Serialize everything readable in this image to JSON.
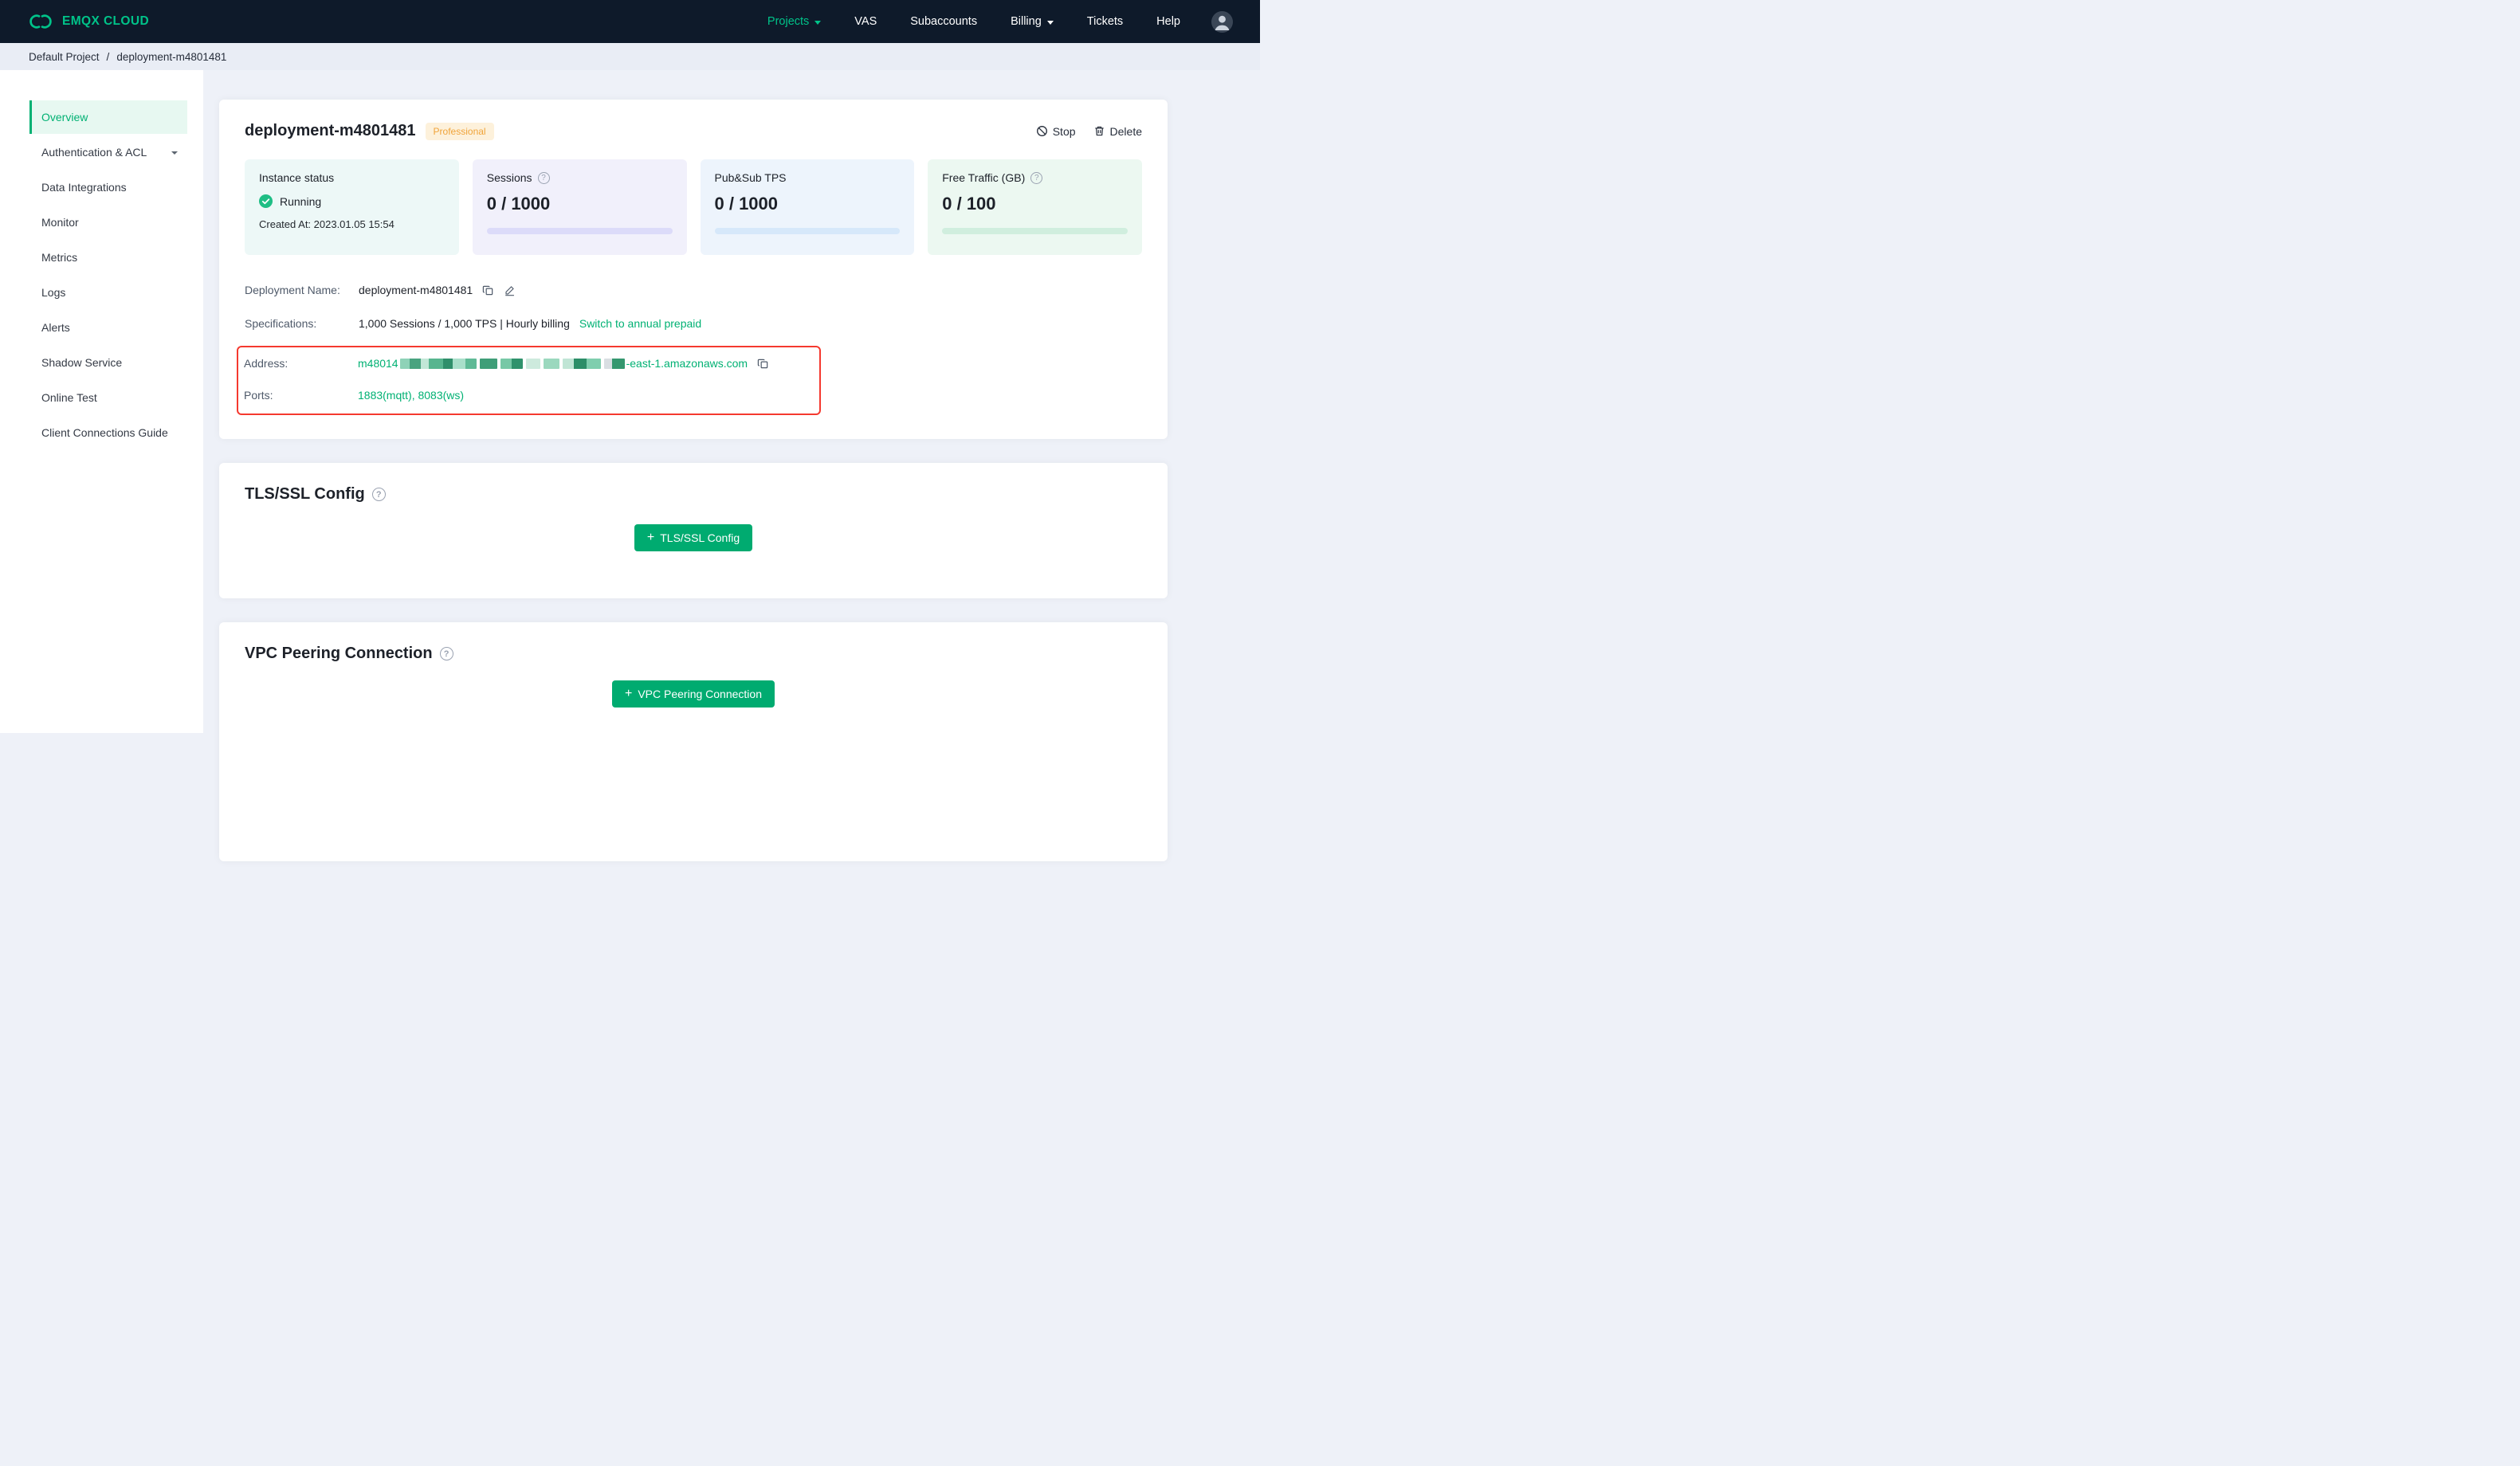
{
  "navbar": {
    "brand": "EMQX CLOUD",
    "items": [
      {
        "label": "Projects",
        "active": true,
        "caret": true
      },
      {
        "label": "VAS"
      },
      {
        "label": "Subaccounts"
      },
      {
        "label": "Billing",
        "caret": true
      },
      {
        "label": "Tickets"
      },
      {
        "label": "Help"
      }
    ]
  },
  "breadcrumb": {
    "project": "Default Project",
    "separator": "/",
    "current": "deployment-m4801481"
  },
  "sidebar": {
    "items": [
      {
        "label": "Overview",
        "active": true
      },
      {
        "label": "Authentication & ACL",
        "caret": true
      },
      {
        "label": "Data Integrations"
      },
      {
        "label": "Monitor"
      },
      {
        "label": "Metrics"
      },
      {
        "label": "Logs"
      },
      {
        "label": "Alerts"
      },
      {
        "label": "Shadow Service"
      },
      {
        "label": "Online Test"
      },
      {
        "label": "Client Connections Guide"
      }
    ]
  },
  "deployment": {
    "title": "deployment-m4801481",
    "badge": "Professional",
    "actions": {
      "stop": "Stop",
      "delete": "Delete"
    },
    "stats": {
      "instance": {
        "label": "Instance status",
        "status": "Running",
        "created_at": "Created At: 2023.01.05 15:54"
      },
      "sessions": {
        "label": "Sessions",
        "value": "0 / 1000",
        "progress_percent": 0
      },
      "tps": {
        "label": "Pub&Sub TPS",
        "value": "0 / 1000",
        "progress_percent": 0
      },
      "traffic": {
        "label": "Free Traffic (GB)",
        "value": "0 / 100",
        "progress_percent": 0
      }
    },
    "info": {
      "name_label": "Deployment Name:",
      "name_value": "deployment-m4801481",
      "spec_label": "Specifications:",
      "spec_value": "1,000 Sessions / 1,000 TPS | Hourly billing",
      "switch_link": "Switch to annual prepaid",
      "address_label": "Address:",
      "address_prefix": "m48014",
      "address_suffix": "-east-1.amazonaws.com",
      "ports_label": "Ports:",
      "ports_value": "1883(mqtt), 8083(ws)"
    }
  },
  "sections": {
    "tls": {
      "title": "TLS/SSL Config",
      "button": "TLS/SSL Config"
    },
    "vpc": {
      "title": "VPC Peering Connection",
      "button": "VPC Peering Connection"
    }
  },
  "colors": {
    "accent_green": "#00b173",
    "button_green": "#00ab70",
    "badge_orange": "#f0a43a",
    "annotation_red": "#f5392f",
    "navbar_dark": "#0e1a2a"
  }
}
